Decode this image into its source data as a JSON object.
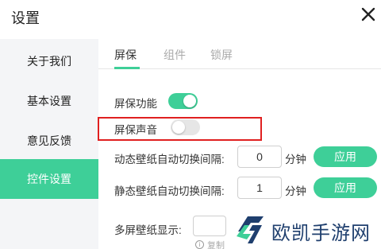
{
  "window": {
    "title": "设置"
  },
  "sidebar": {
    "items": [
      {
        "label": "关于我们"
      },
      {
        "label": "基本设置"
      },
      {
        "label": "意见反馈"
      },
      {
        "label": "控件设置"
      }
    ],
    "active_index": 3
  },
  "tabs": [
    {
      "label": "屏保"
    },
    {
      "label": "组件"
    },
    {
      "label": "锁屏"
    }
  ],
  "settings": {
    "screensaver": {
      "label": "屏保功能",
      "enabled": true
    },
    "screensaver_sound": {
      "label": "屏保声音",
      "enabled": false
    },
    "dynamic_interval": {
      "label": "动态壁纸自动切换间隔:",
      "value": "0",
      "unit": "分钟",
      "apply_label": "应用"
    },
    "static_interval": {
      "label": "静态壁纸自动切换间隔:",
      "value": "1",
      "unit": "分钟",
      "apply_label": "应用"
    },
    "multi_screen": {
      "label": "多屏壁纸显示:",
      "value": "",
      "hint": "复制"
    }
  },
  "colors": {
    "accent": "#3ecf98",
    "highlight": "#e02020",
    "sidebar_bg": "#f4f5f7"
  },
  "icons": {
    "close": "close-icon",
    "info": "info-icon"
  },
  "watermark": {
    "text": "欧凯手游网"
  }
}
